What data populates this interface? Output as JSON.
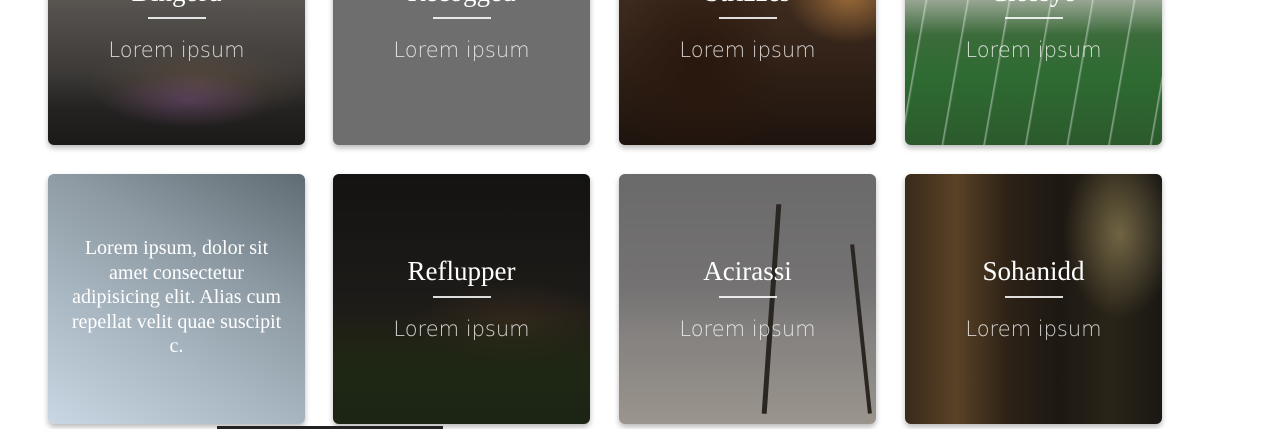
{
  "cards": [
    {
      "title": "Dingord",
      "subtitle": "Lorem ipsum"
    },
    {
      "title": "Recogged",
      "subtitle": "Lorem ipsum"
    },
    {
      "title": "Strizzes",
      "subtitle": "Lorem ipsum"
    },
    {
      "title": "Clossyo",
      "subtitle": "Lorem ipsum"
    },
    {
      "text": "Lorem ipsum, dolor sit amet consectetur adipisicing elit. Alias cum repellat velit quae suscipit c."
    },
    {
      "title": "Reflupper",
      "subtitle": "Lorem ipsum"
    },
    {
      "title": "Acirassi",
      "subtitle": "Lorem ipsum"
    },
    {
      "title": "Sohanidd",
      "subtitle": "Lorem ipsum"
    }
  ]
}
